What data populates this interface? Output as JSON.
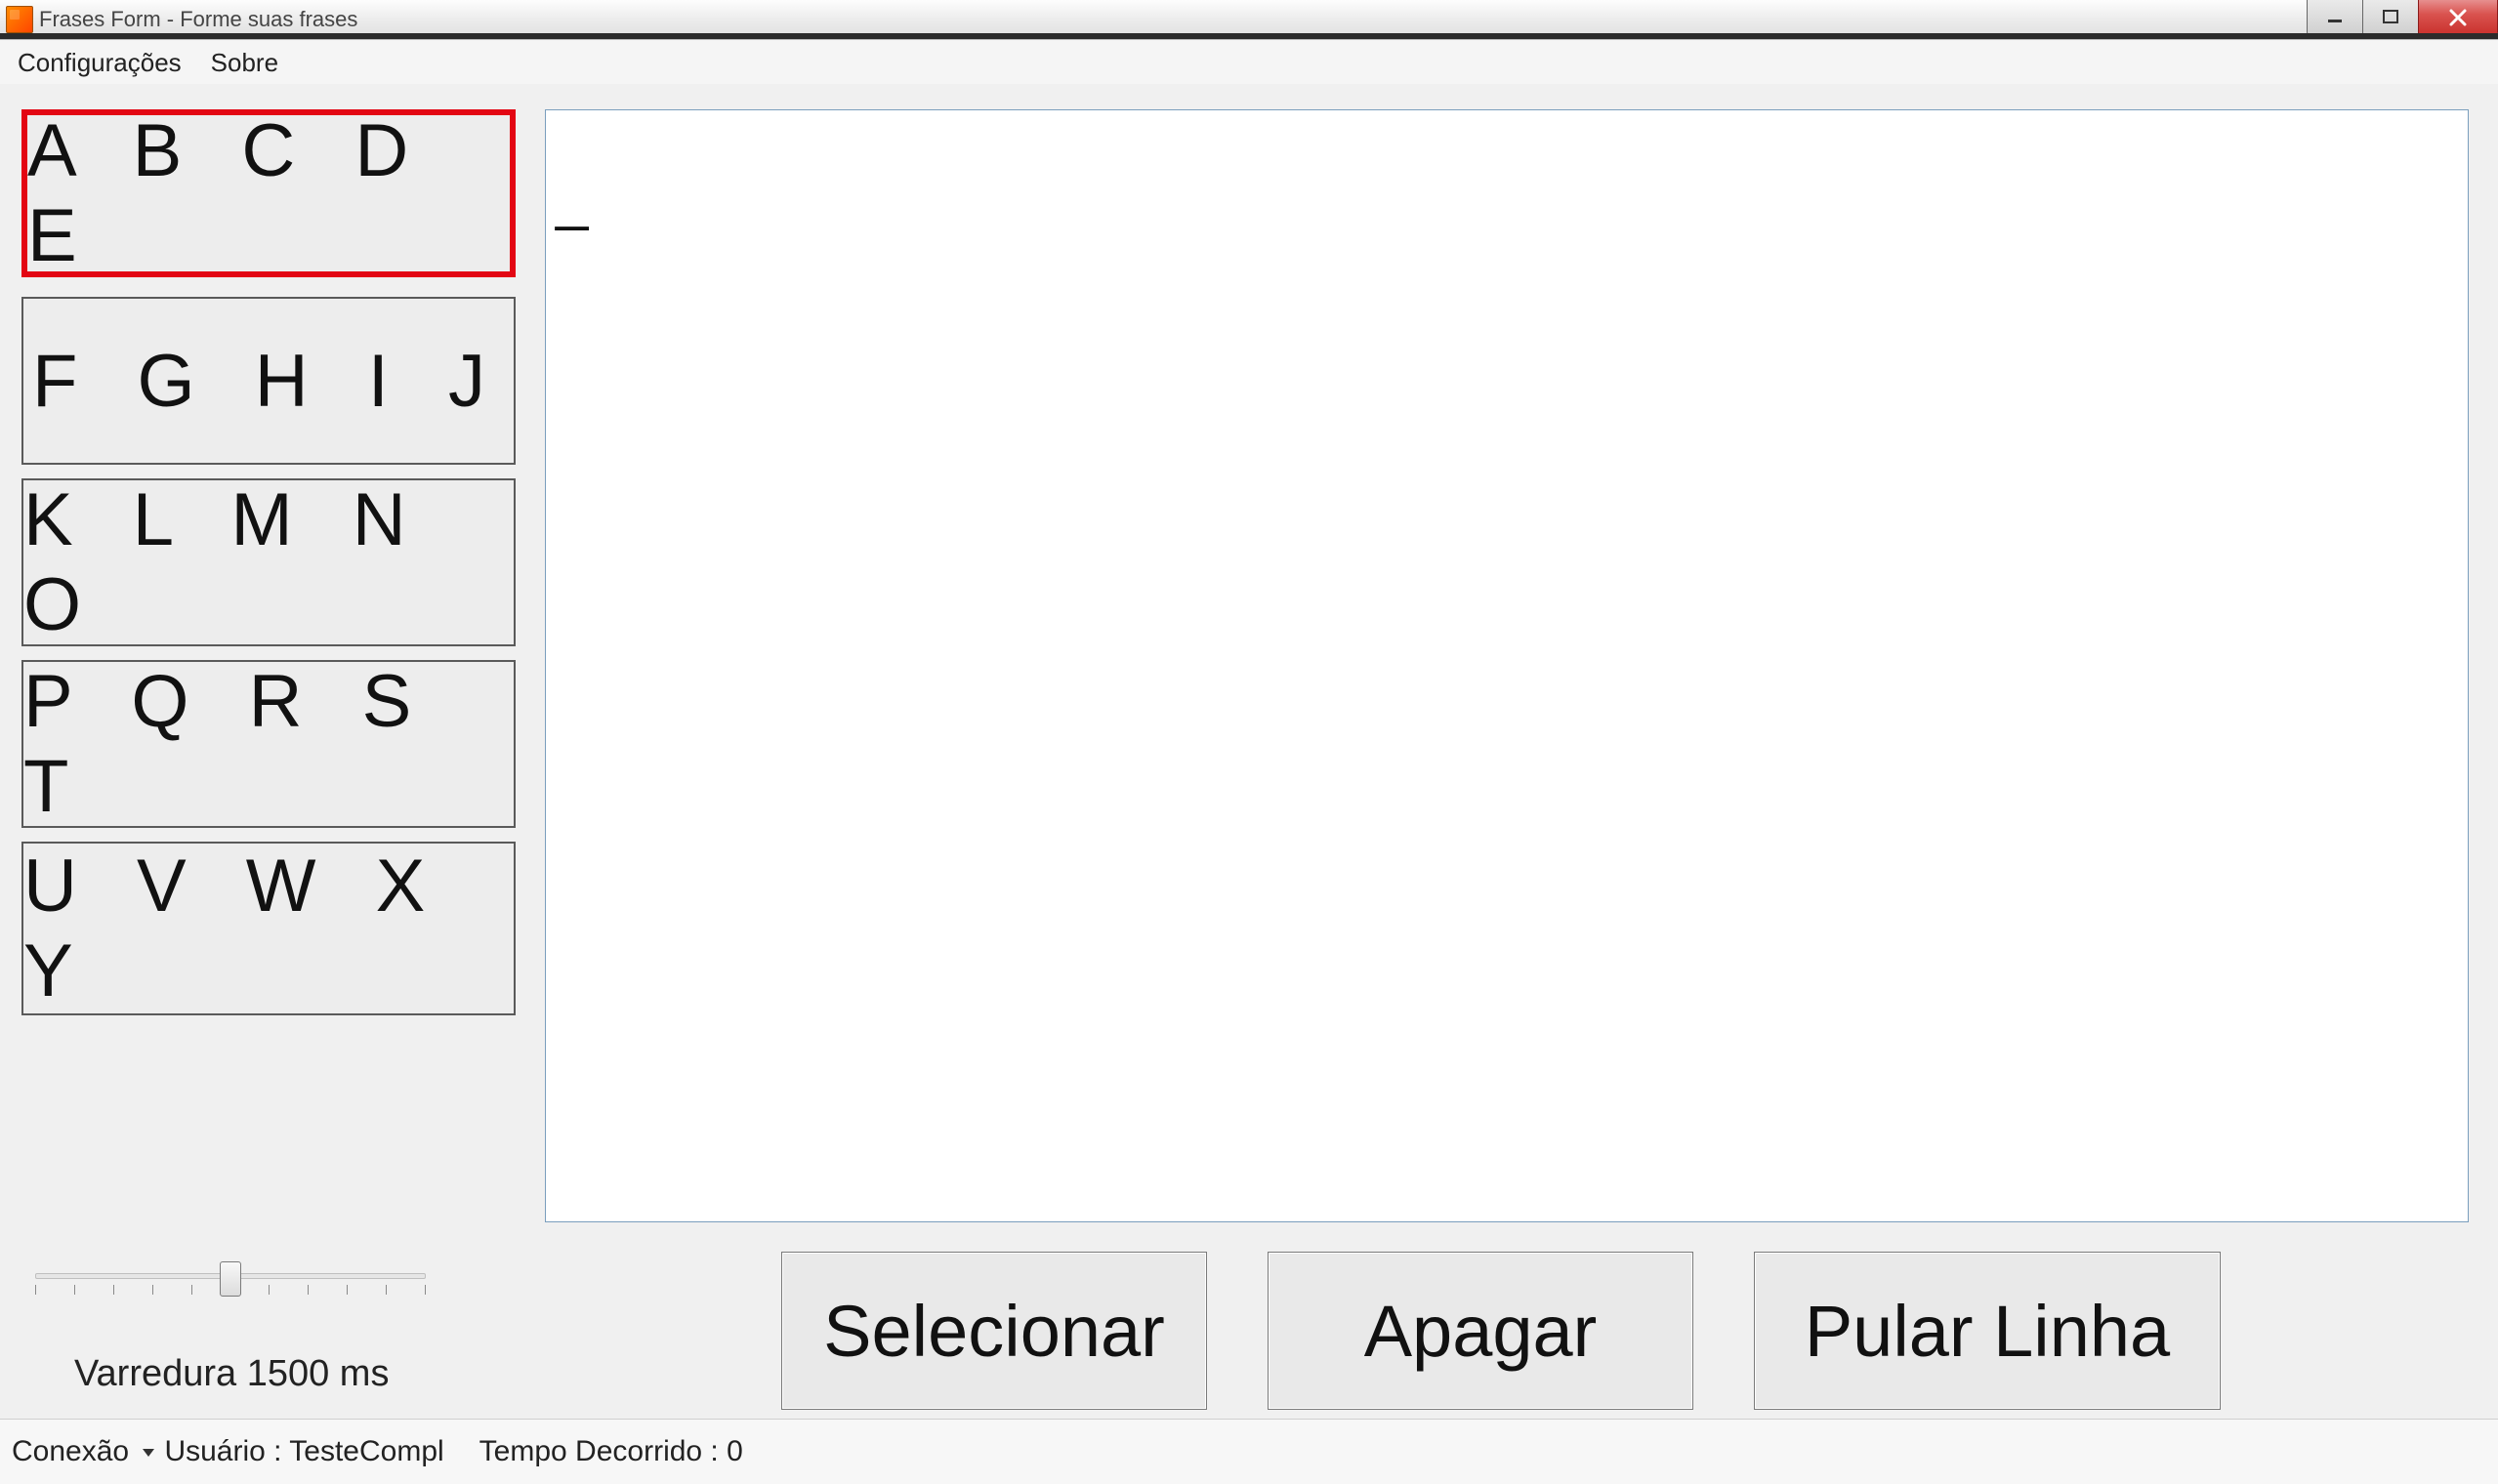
{
  "window": {
    "title": "Frases Form - Forme suas frases"
  },
  "menu": {
    "config": "Configurações",
    "about": "Sobre"
  },
  "letterGroups": {
    "g0": "A B C D E",
    "g1": "F G H I J",
    "g2": "K L M N O",
    "g3": "P Q R S T",
    "g4": "U V W X Y"
  },
  "textArea": {
    "content": "_"
  },
  "scan": {
    "label": "Varredura 1500 ms",
    "value_ms": 1500
  },
  "buttons": {
    "select": "Selecionar",
    "erase": "Apagar",
    "newline": "Pular Linha"
  },
  "status": {
    "connection_label": "Conexão",
    "user_label": "Usuário : TesteCompl",
    "elapsed_label": "Tempo Decorrido : 0"
  }
}
